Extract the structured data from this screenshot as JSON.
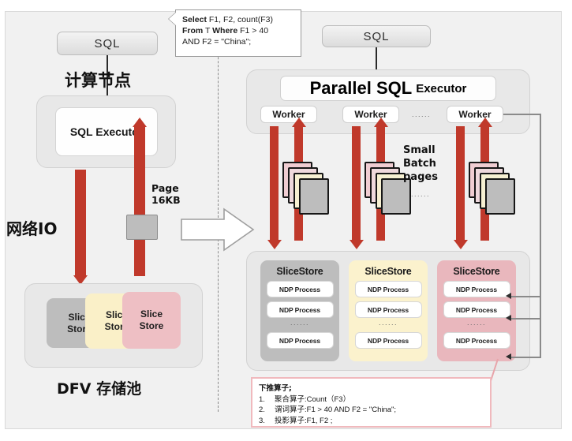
{
  "diagram": {
    "left": {
      "sql_box": "SQL",
      "compute_node_title": "计算节点",
      "sql_executor": "SQL Executor",
      "page_label_line1": "Page",
      "page_label_line2": "16KB",
      "network_io": "网络IO",
      "storage_pool_title": "DFV 存储池",
      "slice_stores": [
        {
          "line1": "Slice",
          "line2": "Store",
          "color": "#bdbdbd"
        },
        {
          "line1": "Slice",
          "line2": "Store",
          "color": "#faf0c8"
        },
        {
          "line1": "Slice",
          "line2": "Store",
          "color": "#eebfc4"
        }
      ]
    },
    "callout": {
      "line1_bold": "Select",
      "line1_rest": " F1, F2, count(F3)",
      "line2_bold1": "From",
      "line2_mid": " T ",
      "line2_bold2": "Where",
      "line2_rest": " F1 > 40",
      "line3": "AND F2 = \"China\";"
    },
    "right": {
      "sql_box": "SQL",
      "executor_title_bold": "Parallel SQL",
      "executor_title_small": "Executor",
      "workers": [
        "Worker",
        "Worker",
        "Worker"
      ],
      "worker_ellipsis": "......",
      "small_batch": [
        "Small",
        "Batch",
        "pages"
      ],
      "batch_ellipsis": "......",
      "slice_store_columns": [
        {
          "title": "SliceStore",
          "bg": "#bdbdbd",
          "processes": [
            "NDP Process",
            "NDP Process",
            "NDP Process"
          ],
          "ellipsis": "......"
        },
        {
          "title": "SliceStore",
          "bg": "#fbf2cd",
          "processes": [
            "NDP Process",
            "NDP Process",
            "NDP Process"
          ],
          "ellipsis": "......"
        },
        {
          "title": "SliceStore",
          "bg": "#e9b7bd",
          "processes": [
            "NDP Process",
            "NDP Process",
            "NDP Process"
          ],
          "ellipsis": "......"
        }
      ]
    },
    "legend": {
      "title": "下推算子;",
      "items": [
        {
          "num": "1.",
          "cn": "聚合算子",
          "sep": ": ",
          "val": "Count（F3）"
        },
        {
          "num": "2.",
          "cn": "谓词算子",
          "sep": ": ",
          "val": "F1 > 40 AND F2 = \"China\";"
        },
        {
          "num": "3.",
          "cn": "投影算子",
          "sep": ": ",
          "val": "F1, F2 ;"
        }
      ]
    },
    "colors": {
      "red_arrow": "#c0392b",
      "panel_bg": "#e8e8e8",
      "page_bg": "#f1f1f1",
      "legend_border": "#f0b9bd"
    }
  }
}
